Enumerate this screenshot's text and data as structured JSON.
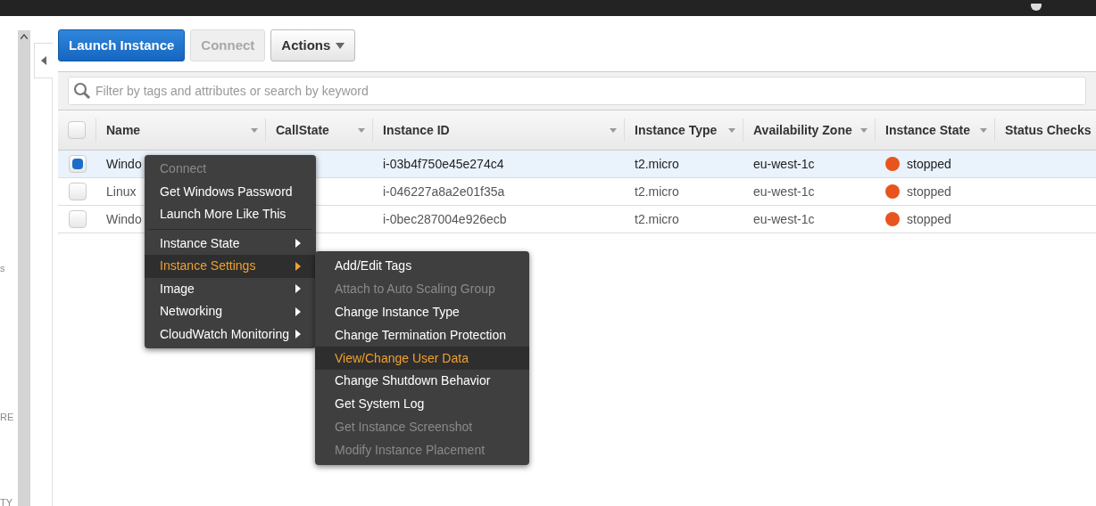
{
  "sidebar": {
    "fragments": [
      "s",
      "RE",
      "TY"
    ]
  },
  "toolbar": {
    "buttons": [
      {
        "label": "Launch Instance",
        "kind": "primary",
        "disabled": false
      },
      {
        "label": "Connect",
        "kind": "plain",
        "disabled": true
      },
      {
        "label": "Actions",
        "kind": "dropdown",
        "disabled": false
      }
    ]
  },
  "search": {
    "placeholder": "Filter by tags and attributes or search by keyword"
  },
  "table": {
    "header_checked": false,
    "columns": [
      "Name",
      "CallState",
      "Instance ID",
      "Instance Type",
      "Availability Zone",
      "Instance State",
      "Status Checks"
    ],
    "rows": [
      {
        "selected": true,
        "name": "Windo",
        "instance_id": "i-03b4f750e45e274c4",
        "type": "t2.micro",
        "zone": "eu-west-1c",
        "state": "stopped",
        "color": "#e8541e"
      },
      {
        "selected": false,
        "name": "Linux",
        "instance_id": "i-046227a8a2e01f35a",
        "type": "t2.micro",
        "zone": "eu-west-1c",
        "state": "stopped",
        "color": "#e8541e"
      },
      {
        "selected": false,
        "name": "Windo",
        "instance_id": "i-0bec287004e926ecb",
        "type": "t2.micro",
        "zone": "eu-west-1c",
        "state": "stopped",
        "color": "#e8541e"
      }
    ]
  },
  "context_menu": {
    "sections": [
      [
        {
          "label": "Connect",
          "kind": "action",
          "disabled": true,
          "selected": false
        },
        {
          "label": "Get Windows Password",
          "kind": "action",
          "disabled": false,
          "selected": false
        },
        {
          "label": "Launch More Like This",
          "kind": "action",
          "disabled": false,
          "selected": false
        }
      ],
      [
        {
          "label": "Instance State",
          "kind": "submenu",
          "disabled": false,
          "selected": false
        },
        {
          "label": "Instance Settings",
          "kind": "submenu",
          "disabled": false,
          "selected": true
        },
        {
          "label": "Image",
          "kind": "submenu",
          "disabled": false,
          "selected": false
        },
        {
          "label": "Networking",
          "kind": "submenu",
          "disabled": false,
          "selected": false
        },
        {
          "label": "CloudWatch Monitoring",
          "kind": "submenu",
          "disabled": false,
          "selected": false
        }
      ]
    ]
  },
  "submenu": {
    "items": [
      {
        "label": "Add/Edit Tags",
        "disabled": false,
        "selected": false
      },
      {
        "label": "Attach to Auto Scaling Group",
        "disabled": true,
        "selected": false
      },
      {
        "label": "Change Instance Type",
        "disabled": false,
        "selected": false
      },
      {
        "label": "Change Termination Protection",
        "disabled": false,
        "selected": false
      },
      {
        "label": "View/Change User Data",
        "disabled": false,
        "selected": true
      },
      {
        "label": "Change Shutdown Behavior",
        "disabled": false,
        "selected": false
      },
      {
        "label": "Get System Log",
        "disabled": false,
        "selected": false
      },
      {
        "label": "Get Instance Screenshot",
        "disabled": true,
        "selected": false
      },
      {
        "label": "Modify Instance Placement",
        "disabled": true,
        "selected": false
      }
    ]
  }
}
